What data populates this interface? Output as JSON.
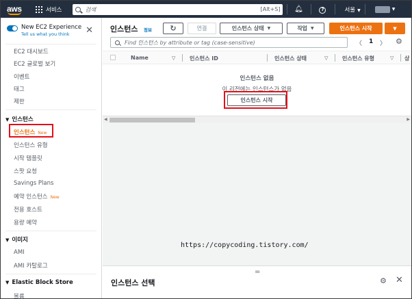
{
  "topbar": {
    "logo": "aws",
    "services_label": "서비스",
    "search_placeholder": "검색",
    "search_shortcut": "[Alt+S]",
    "region": "서울"
  },
  "sidebar": {
    "toggle_title": "New EC2 Experience",
    "toggle_sub": "Tell us what you think",
    "items_top": [
      "EC2 대시보드",
      "EC2 글로벌 보기",
      "이벤트",
      "태그",
      "제한"
    ],
    "section_instances": "인스턴스",
    "instances_items": [
      "인스턴스",
      "인스턴스 유형",
      "시작 템플릿",
      "스팟 요청",
      "Savings Plans",
      "예약 인스턴스",
      "전용 호스트",
      "용량 예약"
    ],
    "new_badge": "New",
    "section_images": "이미지",
    "images_items": [
      "AMI",
      "AMI 카탈로그"
    ],
    "section_ebs": "Elastic Block Store",
    "ebs_items": [
      "볼륨"
    ]
  },
  "main": {
    "title": "인스턴스",
    "info": "정보",
    "btn_connect": "연결",
    "btn_state": "인스턴스 상태",
    "btn_actions": "작업",
    "btn_launch": "인스턴스 시작",
    "filter_placeholder": "Find 인스턴스 by attribute or tag (case-sensitive)",
    "page_number": "1",
    "columns": [
      "Name",
      "인스턴스 ID",
      "인스턴스 상태",
      "인스턴스 유형",
      "상"
    ],
    "empty_title": "인스턴스 없음",
    "empty_sub": "이 리전에는 인스턴스가 없음",
    "empty_button": "인스턴스 시작",
    "split_title": "인스턴스 선택"
  },
  "watermark": "https://copycoding.tistory.com/",
  "colors": {
    "accent": "#ec7211",
    "link": "#0073bb",
    "nav_bg": "#232f3e",
    "highlight": "#e0101a"
  }
}
